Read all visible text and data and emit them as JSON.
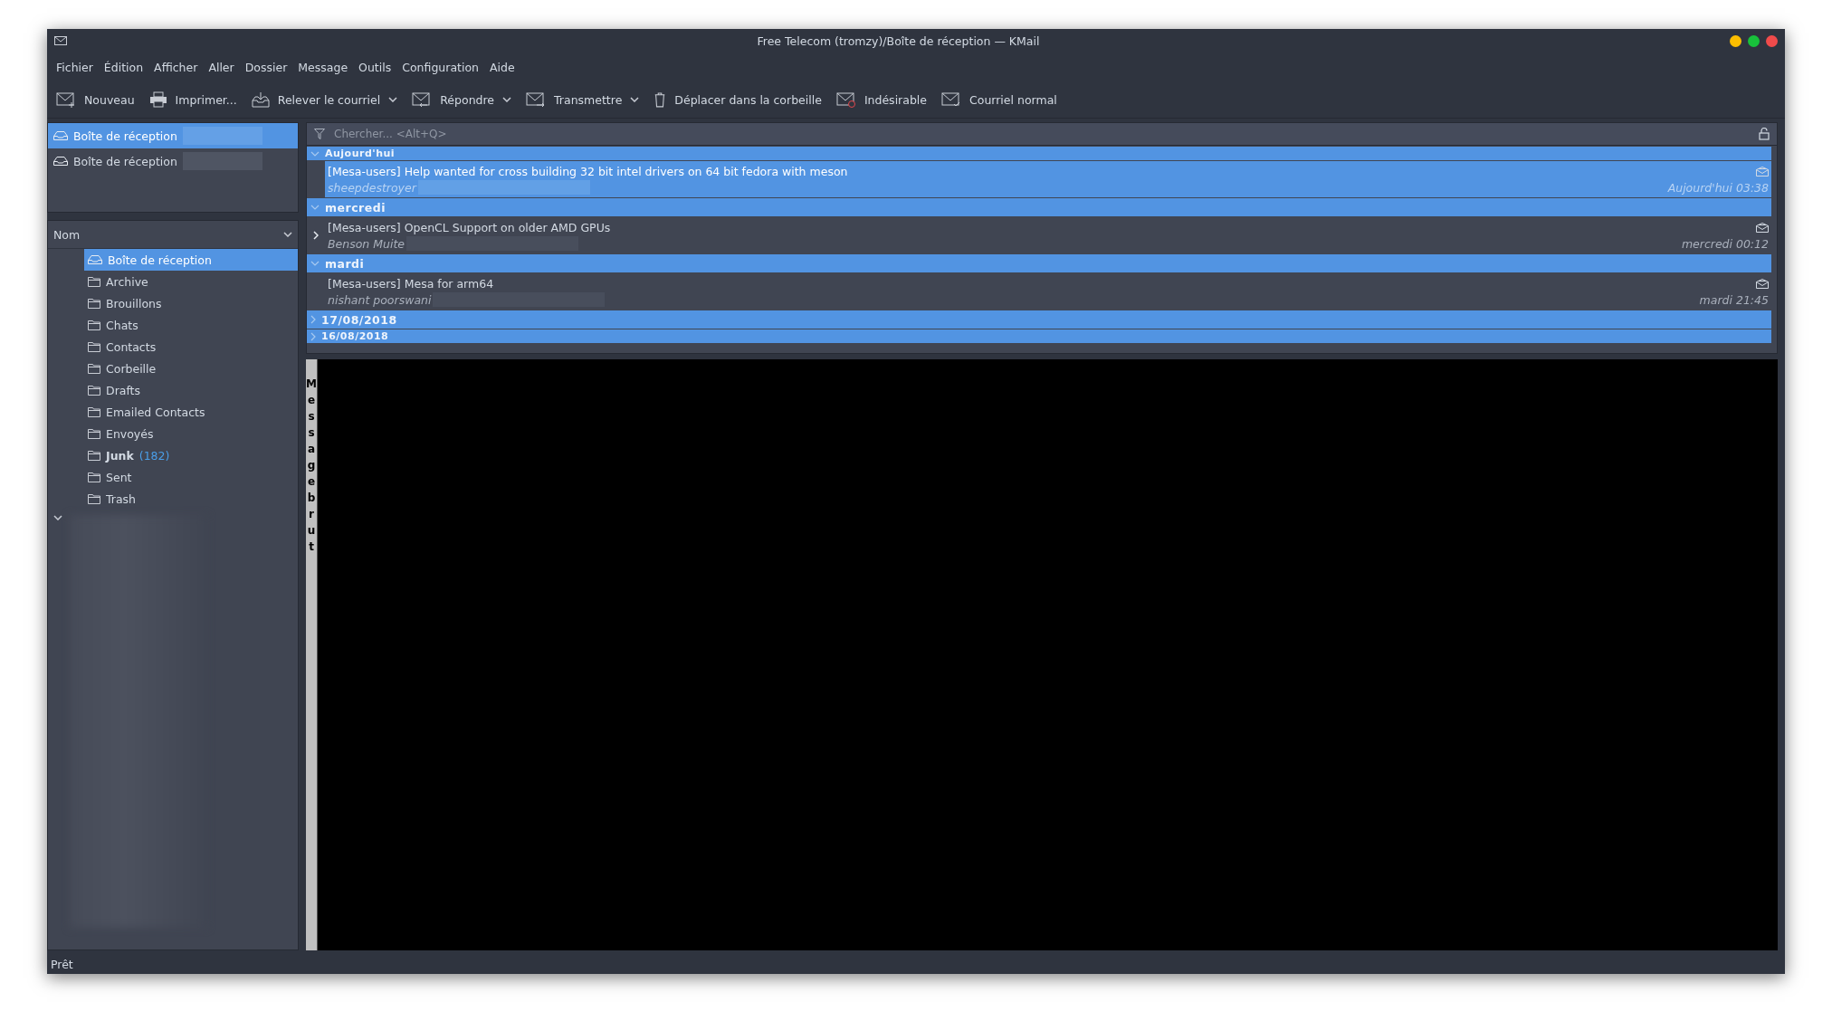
{
  "window": {
    "title": "Free Telecom (tromzy)/Boîte de réception — KMail"
  },
  "menu": [
    "Fichier",
    "Édition",
    "Afficher",
    "Aller",
    "Dossier",
    "Message",
    "Outils",
    "Configuration",
    "Aide"
  ],
  "toolbar": [
    {
      "kind": "new",
      "label": "Nouveau",
      "menu": false
    },
    {
      "kind": "print",
      "label": "Imprimer...",
      "menu": false
    },
    {
      "kind": "fetch",
      "label": "Relever le courriel",
      "menu": true
    },
    {
      "kind": "reply",
      "label": "Répondre",
      "menu": true
    },
    {
      "kind": "forward",
      "label": "Transmettre",
      "menu": true
    },
    {
      "kind": "trash",
      "label": "Déplacer dans la corbeille",
      "menu": false
    },
    {
      "kind": "spam",
      "label": "Indésirable",
      "menu": false
    },
    {
      "kind": "ham",
      "label": "Courriel normal",
      "menu": false
    }
  ],
  "favorites": [
    {
      "label": "Boîte de réception",
      "selected": true
    },
    {
      "label": "Boîte de réception",
      "selected": false
    }
  ],
  "folder_tree": {
    "header": "Nom",
    "items": [
      {
        "label": "Boîte de réception",
        "kind": "inbox",
        "selected": true,
        "unread": false,
        "children": [
          {
            "label": "Archive",
            "kind": "folder",
            "selected": false,
            "unread": false
          },
          {
            "label": "Brouillons",
            "kind": "folder",
            "selected": false,
            "unread": false
          },
          {
            "label": "Chats",
            "kind": "folder",
            "selected": false,
            "unread": false
          },
          {
            "label": "Contacts",
            "kind": "folder",
            "selected": false,
            "unread": false
          },
          {
            "label": "Corbeille",
            "kind": "folder",
            "selected": false,
            "unread": false
          },
          {
            "label": "Drafts",
            "kind": "folder",
            "selected": false,
            "unread": false
          },
          {
            "label": "Emailed Contacts",
            "kind": "folder",
            "selected": false,
            "unread": false
          },
          {
            "label": "Envoyés",
            "kind": "folder",
            "selected": false,
            "unread": false
          },
          {
            "label": "Junk",
            "count": "(182)",
            "kind": "folder",
            "selected": false,
            "unread": true
          },
          {
            "label": "Sent",
            "kind": "folder",
            "selected": false,
            "unread": false
          },
          {
            "label": "Trash",
            "kind": "folder",
            "selected": false,
            "unread": false
          }
        ]
      }
    ]
  },
  "search": {
    "placeholder": "Chercher... <Alt+Q>"
  },
  "message_groups": [
    {
      "label": "Aujourd'hui",
      "expanded": true,
      "cut": true,
      "messages": [
        {
          "subject": "[Mesa-users] Help wanted for cross building 32 bit intel drivers on 64 bit fedora with meson",
          "sender": "sheepdestroyer",
          "date": "Aujourd'hui 03:38",
          "selected": true,
          "thread_collapsed": false
        }
      ]
    },
    {
      "label": "mercredi",
      "expanded": true,
      "cut": false,
      "messages": [
        {
          "subject": "[Mesa-users] OpenCL Support on older AMD GPUs",
          "sender": "Benson Muite",
          "date": "mercredi 00:12",
          "selected": false,
          "thread_collapsed": true
        }
      ]
    },
    {
      "label": "mardi",
      "expanded": true,
      "cut": false,
      "messages": [
        {
          "subject": "[Mesa-users] Mesa for arm64",
          "sender": "nishant poorswani",
          "date": "mardi 21:45",
          "selected": false,
          "thread_collapsed": false
        }
      ]
    },
    {
      "label": "17/08/2018",
      "expanded": false,
      "cut": false
    },
    {
      "label": "16/08/2018",
      "expanded": false,
      "cut": true
    }
  ],
  "preview": {
    "side_label": "Message brut"
  },
  "status_bar": "Prêt"
}
